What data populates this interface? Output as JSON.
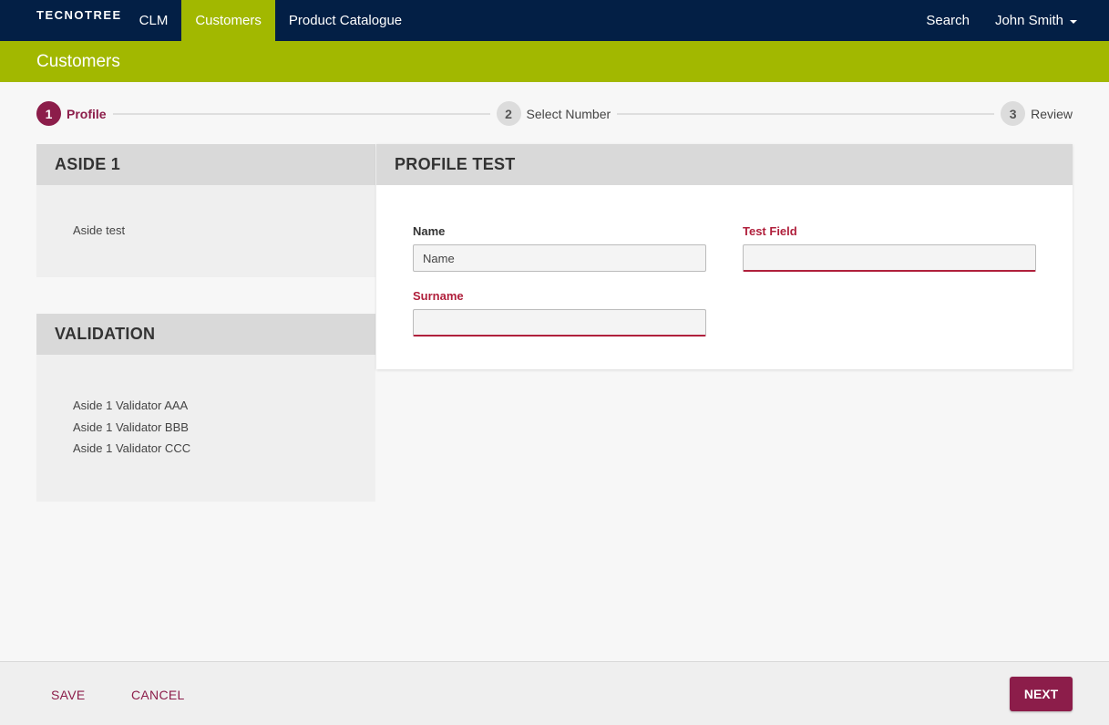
{
  "nav": {
    "brand": "TECNOTREE",
    "links": [
      {
        "label": "CLM"
      },
      {
        "label": "Customers",
        "active": true
      },
      {
        "label": "Product Catalogue"
      }
    ],
    "search_label": "Search",
    "user_name": "John Smith"
  },
  "page": {
    "title": "Customers"
  },
  "stepper": {
    "steps": [
      {
        "num": "1",
        "label": "Profile",
        "active": true
      },
      {
        "num": "2",
        "label": "Select Number"
      },
      {
        "num": "3",
        "label": "Review"
      }
    ]
  },
  "aside1": {
    "title": "ASIDE 1",
    "text": "Aside test"
  },
  "validation": {
    "title": "VALIDATION",
    "items": [
      "Aside 1 Validator AAA",
      "Aside 1 Validator BBB",
      "Aside 1 Validator CCC"
    ]
  },
  "profile": {
    "title": "PROFILE TEST",
    "fields": {
      "name": {
        "label": "Name",
        "value": "Name"
      },
      "test_field": {
        "label": "Test Field",
        "value": ""
      },
      "surname": {
        "label": "Surname",
        "value": ""
      }
    }
  },
  "footer": {
    "save_label": "SAVE",
    "cancel_label": "CANCEL",
    "next_label": "NEXT"
  },
  "colors": {
    "navy": "#031f45",
    "lime": "#a2b800",
    "brand": "#8c1d4a",
    "error": "#b0203c"
  }
}
